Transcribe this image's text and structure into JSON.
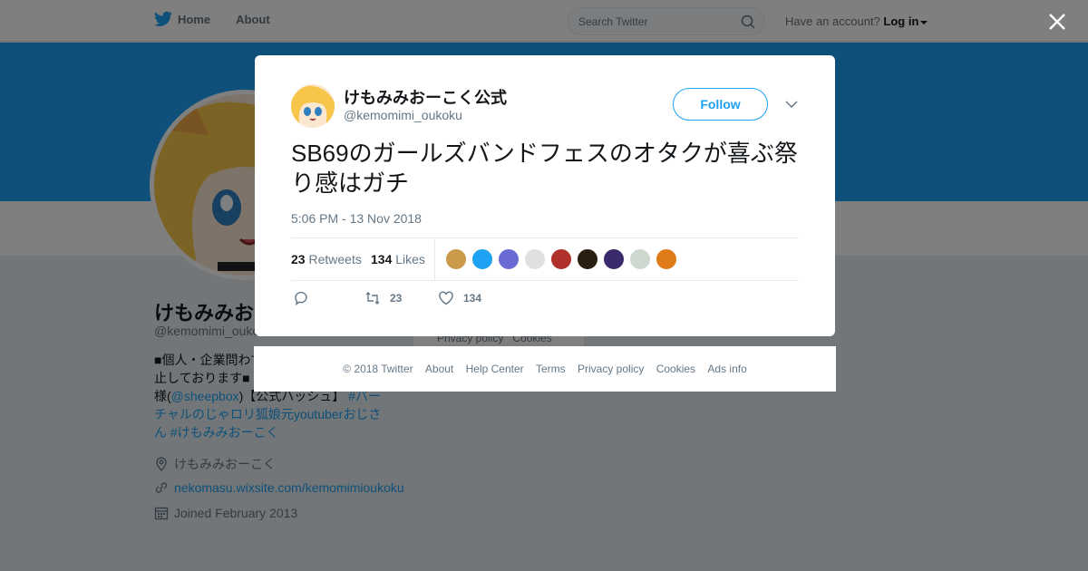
{
  "topbar": {
    "home_label": "Home",
    "about_label": "About",
    "search_placeholder": "Search Twitter",
    "account_prompt": "Have an account?",
    "login_label": "Log in"
  },
  "profile": {
    "name": "けもみみおーこく公式",
    "handle": "@kemomimi_oukoku",
    "bio_line1": "■個人・企業問わず",
    "bio_line2": "止しております■",
    "bio_line3_a": "様(",
    "bio_line3_link": "@sheepbox",
    "bio_line3_b": ")【公式ハッシュ】",
    "bio_hashtag1": "#バーチャルのじゃロリ狐娘元youtuberおじさん",
    "bio_hashtag2": "#けもみみおーこく",
    "location": "けもみみおーこく",
    "website": "nekomasu.wixsite.com/kemomimioukoku",
    "joined": "Joined February 2013"
  },
  "side_footer": {
    "privacy": "Privacy policy",
    "cookies": "Cookies"
  },
  "tweet": {
    "author_name": "けもみみおーこく公式",
    "author_handle": "@kemomimi_oukoku",
    "follow_label": "Follow",
    "text": "SB69のガールズバンドフェスのオタクが喜ぶ祭り感はガチ",
    "timestamp": "5:06 PM - 13 Nov 2018",
    "retweets_count": "23",
    "retweets_label": "Retweets",
    "likes_count": "134",
    "likes_label": "Likes",
    "action_retweets": "23",
    "action_likes": "134"
  },
  "likers": [
    {
      "color": "#c89a4a"
    },
    {
      "color": "#1da1f2"
    },
    {
      "color": "#6b6bd6"
    },
    {
      "color": "#e0e0e0"
    },
    {
      "color": "#b0302c"
    },
    {
      "color": "#2a1e10"
    },
    {
      "color": "#3b2a6b"
    },
    {
      "color": "#cfd8cf"
    },
    {
      "color": "#e07b1a"
    }
  ],
  "modal_footer": {
    "copyright": "© 2018 Twitter",
    "about": "About",
    "help": "Help Center",
    "terms": "Terms",
    "privacy": "Privacy policy",
    "cookies": "Cookies",
    "ads": "Ads info"
  },
  "colors": {
    "accent": "#1da1f2",
    "overlay": "rgba(0,0,0,0.5)"
  }
}
